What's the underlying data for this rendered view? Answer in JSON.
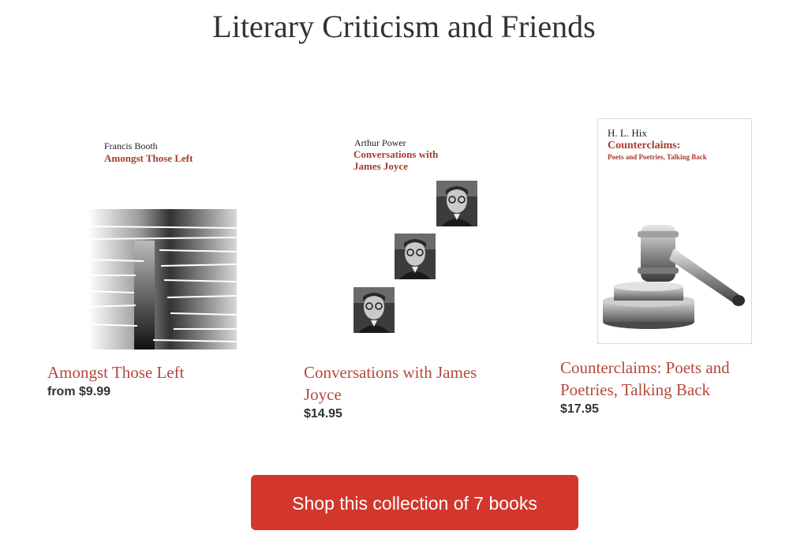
{
  "header": {
    "title": "Literary Criticism and Friends"
  },
  "books": [
    {
      "cover_author": "Francis Booth",
      "cover_title": "Amongst Those Left",
      "title": "Amongst Those Left",
      "price": "from $9.99"
    },
    {
      "cover_author": "Arthur Power",
      "cover_title_line1": "Conversations with",
      "cover_title_line2": "James Joyce",
      "title": "Conversations with James Joyce",
      "price": "$14.95"
    },
    {
      "cover_author": "H. L. Hix",
      "cover_title": "Counterclaims:",
      "cover_subtitle": "Poets and Poetries, Talking Back",
      "title": "Counterclaims: Poets and Poetries, Talking Back",
      "price": "$17.95"
    }
  ],
  "cta": {
    "label": "Shop this collection of 7 books"
  },
  "colors": {
    "accent": "#d3362b",
    "title_link": "#b5483c",
    "text": "#333333"
  }
}
